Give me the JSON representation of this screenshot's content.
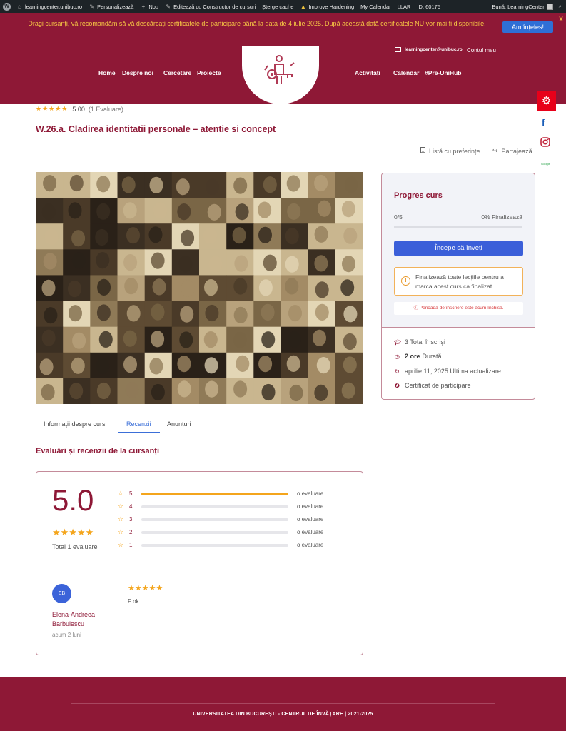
{
  "adminbar": {
    "site": "learningcenter.unibuc.ro",
    "customize": "Personalizează",
    "new": "Nou",
    "builder": "Editează cu Constructor de cursuri",
    "cache": "Șterge cache",
    "hardening": "Improve Hardening",
    "calendar": "My Calendar",
    "llar": "LLAR",
    "id": "ID: 60175",
    "greeting": "Bună, LearningCenter"
  },
  "notice": {
    "text": "Dragi cursanți, vă recomandăm să vă descărcați certificatele de participare până la data de 4 iulie 2025. După această dată certificatele NU vor mai fi disponibile.",
    "button": "Am înțeles!",
    "close": "X"
  },
  "header": {
    "email": "learningcenter@unibuc.ro",
    "account": "Contul meu",
    "nav_left": [
      "Home",
      "Despre noi",
      "Cercetare",
      "Proiecte"
    ],
    "nav_right": [
      "Activități",
      "Calendar",
      "#Pre-UniHub"
    ]
  },
  "social": {
    "facebook": "f",
    "google": "Google"
  },
  "course": {
    "rating_value": "5.00",
    "rating_count": "(1 Evaluare)",
    "title": "W.26.a. Cladirea identitatii personale – atentie si concept",
    "wishlist": "Listă cu preferințe",
    "share": "Partajează"
  },
  "tabs": [
    "Informații despre curs",
    "Recenzii",
    "Anunțuri"
  ],
  "reviews": {
    "section_title": "Evaluări și recenzii de la cursanți",
    "score": "5.0",
    "total": "Total 1 evaluare",
    "bars": [
      {
        "star": "5",
        "label": "o evaluare",
        "fraction": 1.0
      },
      {
        "star": "4",
        "label": "o evaluare",
        "fraction": 0
      },
      {
        "star": "3",
        "label": "o evaluare",
        "fraction": 0
      },
      {
        "star": "2",
        "label": "o evaluare",
        "fraction": 0
      },
      {
        "star": "1",
        "label": "o evaluare",
        "fraction": 0
      }
    ],
    "review": {
      "initials": "EB",
      "name": "Elena-Andreea Barbulescu",
      "time": "acum 2 luni",
      "text": "F ok"
    }
  },
  "progress": {
    "title": "Progres curs",
    "count": "0/5",
    "percent": "0% Finalizează",
    "progress_fraction": 0,
    "start_button": "Începe să înveți",
    "info": "Finalizează toate lecțiile pentru a marca acest curs ca finalizat",
    "closed": "Perioada de înscriere este acum închisă.",
    "enrolled": "3 Total înscriși",
    "duration_value": "2 ore",
    "duration_label": "Durată",
    "updated": "aprilie 11, 2025 Ultima actualizare",
    "certificate": "Certificat de participare"
  },
  "footer": {
    "text": "UNIVERSITATEA DIN BUCUREȘTI - CENTRUL DE ÎNVĂȚARE | 2021-2025"
  },
  "colors": {
    "brand": "#8e1836",
    "accent": "#3b5fd9",
    "star": "#f4a51c"
  }
}
